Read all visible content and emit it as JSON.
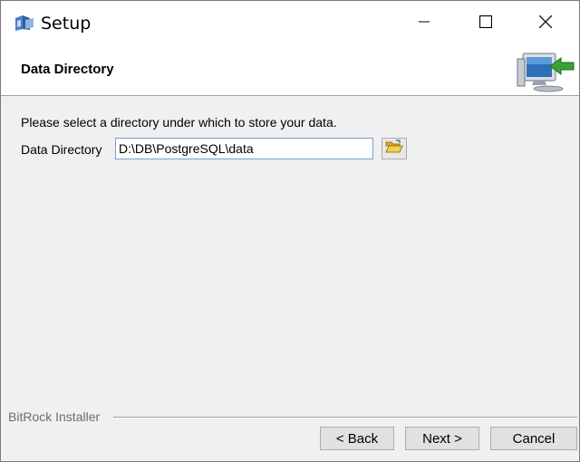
{
  "window": {
    "title": "Setup",
    "app_icon": "setup-app-icon",
    "controls": {
      "minimize_icon": "minimize-icon",
      "maximize_icon": "maximize-icon",
      "close_icon": "close-icon"
    }
  },
  "header": {
    "title": "Data Directory",
    "art_icon": "computer-arrow-icon"
  },
  "content": {
    "instruction": "Please select a directory under which to store your data.",
    "data_directory_label": "Data Directory",
    "data_directory_value": "D:\\DB\\PostgreSQL\\data",
    "browse_icon": "folder-open-icon"
  },
  "footer": {
    "vendor": "BitRock Installer",
    "back_label": "< Back",
    "next_label": "Next >",
    "cancel_label": "Cancel"
  },
  "colors": {
    "titlebar_bg": "#ffffff",
    "body_bg": "#f0f0f0",
    "input_border": "#7a9fd2",
    "button_bg": "#e1e1e1"
  }
}
